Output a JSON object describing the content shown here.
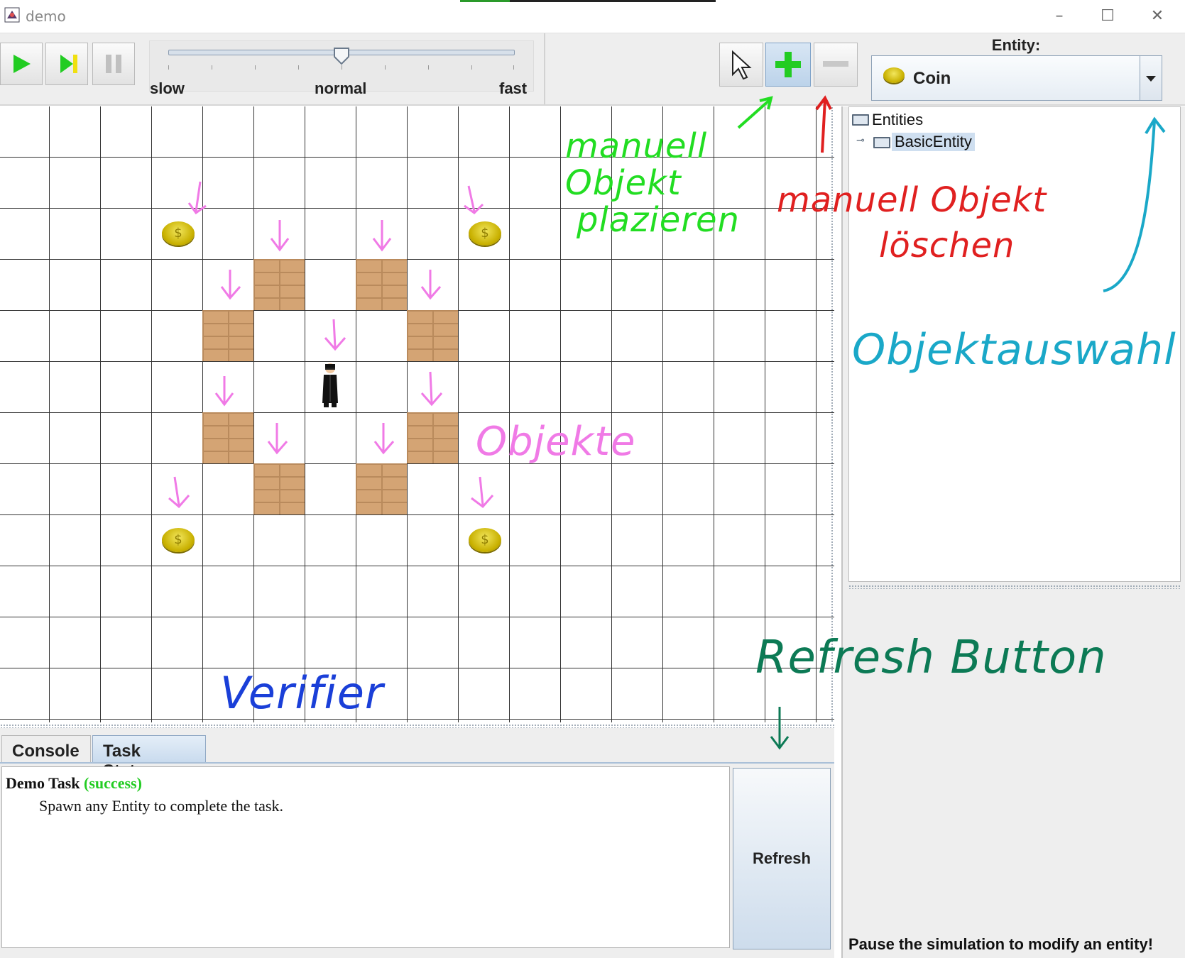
{
  "window": {
    "title": "demo"
  },
  "toolbar": {
    "speed": {
      "labels": {
        "slow": "slow",
        "normal": "normal",
        "fast": "fast"
      },
      "value_label": "normal"
    }
  },
  "entity_selector": {
    "label": "Entity:",
    "selected": "Coin"
  },
  "tree": {
    "root": "Entities",
    "child": "BasicEntity"
  },
  "tabs": [
    "Console",
    "Task Status"
  ],
  "task": {
    "name": "Demo Task",
    "status": "(success)",
    "description": "Spawn any Entity to complete the task."
  },
  "refresh_label": "Refresh",
  "pause_message": "Pause the simulation to modify an entity!",
  "annotations": {
    "place": [
      "manuell",
      "Objekt",
      "plazieren"
    ],
    "delete": [
      "manuell Objekt",
      "löschen"
    ],
    "selection": "Objektauswahl",
    "objects": "Objekte",
    "verifier": "Verifier",
    "refresh": "Refresh Button"
  },
  "colors": {
    "accent_green": "#22cc22",
    "annotation_green": "#22dd22",
    "annotation_red": "#e02020",
    "annotation_cyan": "#1aa8c8",
    "annotation_pink": "#f07ae6",
    "annotation_blue": "#1a3fd8",
    "annotation_teal": "#0c7a55"
  }
}
